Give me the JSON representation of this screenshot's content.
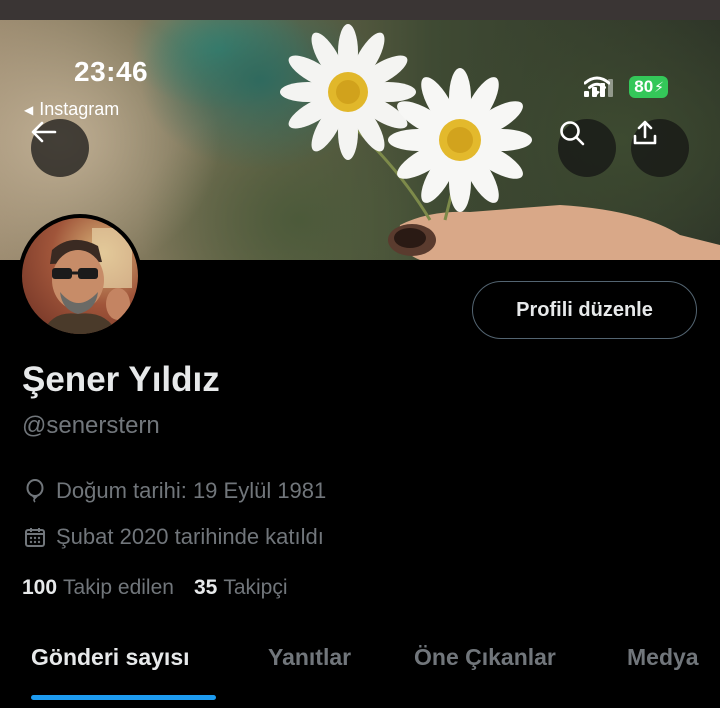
{
  "status_bar": {
    "time": "23:46",
    "back_app_label": "Instagram",
    "battery": "80"
  },
  "header": {
    "back_icon": "arrow-left-icon",
    "search_icon": "search-icon",
    "share_icon": "share-icon"
  },
  "profile": {
    "edit_button_label": "Profili düzenle",
    "display_name": "Şener Yıldız",
    "handle": "@senerstern",
    "birthday": "Doğum tarihi: 19 Eylül 1981",
    "joined": "Şubat 2020 tarihinde katıldı",
    "following_count": "100",
    "following_label": "Takip edilen",
    "followers_count": "35",
    "followers_label": "Takipçi"
  },
  "tabs": [
    {
      "label": "Gönderi sayısı",
      "active": true
    },
    {
      "label": "Yanıtlar",
      "active": false
    },
    {
      "label": "Öne Çıkanlar",
      "active": false
    },
    {
      "label": "Medya",
      "active": false
    }
  ],
  "colors": {
    "background": "#000000",
    "accent": "#1d9bf0",
    "text_primary": "#e7e9ea",
    "text_secondary": "#71767b",
    "battery": "#34c759"
  }
}
